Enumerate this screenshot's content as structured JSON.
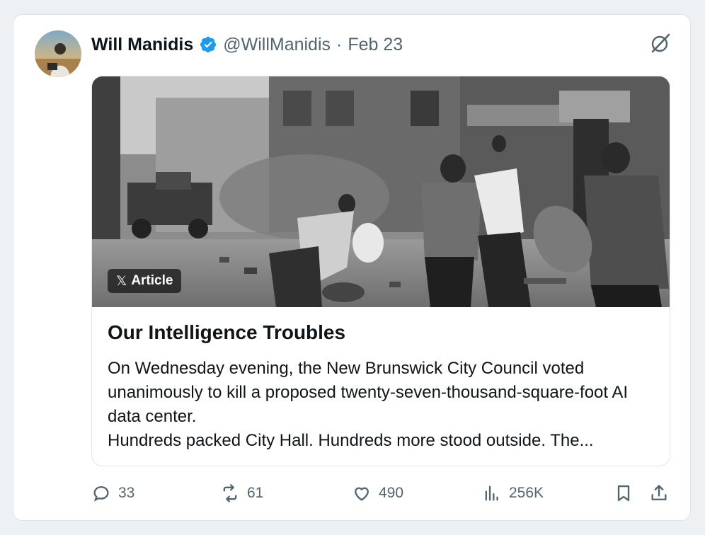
{
  "tweet": {
    "author": {
      "display_name": "Will Manidis",
      "handle": "@WillManidis",
      "separator": "·",
      "date": "Feb 23",
      "verified": true,
      "avatar_icon": "user-avatar-photo"
    },
    "article": {
      "badge_x": "𝕏",
      "badge_label": "Article",
      "title": "Our Intelligence Troubles",
      "body_lines": [
        "On Wednesday evening, the New Brunswick City Council voted unanimously to kill a proposed twenty-seven-thousand-square-foot AI data center.",
        "Hundreds packed City Hall. Hundreds more stood outside. The..."
      ],
      "image_icon": "black-and-white-street-photo"
    },
    "actions": {
      "replies": "33",
      "reposts": "61",
      "likes": "490",
      "views": "256K"
    },
    "colors": {
      "verified_blue": "#1d9bf0",
      "text_primary": "#0f1419",
      "text_secondary": "#536471"
    }
  }
}
